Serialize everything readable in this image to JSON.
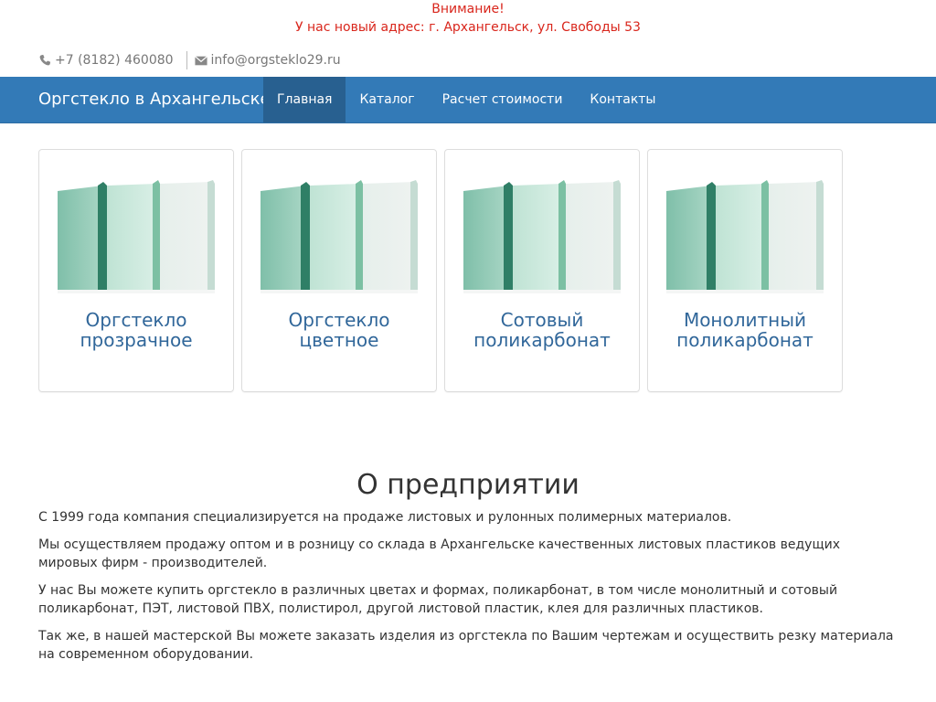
{
  "notice": {
    "title": "Внимание!",
    "text": "У нас новый адрес: г. Архангельск, ул. Свободы 53"
  },
  "contacts": {
    "phone": "+7 (8182) 460080",
    "email": "info@orgsteklo29.ru"
  },
  "navbar": {
    "brand": "Оргстекло в Архангельске",
    "items": [
      "Главная",
      "Каталог",
      "Расчет стоимости",
      "Контакты"
    ],
    "active": 0
  },
  "products": [
    {
      "line1": "Оргстекло",
      "line2": "прозрачное"
    },
    {
      "line1": "Оргстекло",
      "line2": "цветное"
    },
    {
      "line1": "Сотовый",
      "line2": "поликарбонат"
    },
    {
      "line1": "Монолитный",
      "line2": "поликарбонат"
    }
  ],
  "about": {
    "heading": "О предприятии",
    "paragraphs": [
      "С 1999 года компания специализируется на продаже листовых и рулонных полимерных материалов.",
      "Мы осуществляем продажу оптом и в розницу со склада в Архангельске качественных листовых пластиков ведущих мировых фирм - производителей.",
      "У нас Вы можете купить оргстекло в различных цветах и формах, поликарбонат, в том числе монолитный и сотовый поликарбонат, ПЭТ, листовой ПВХ, полистирол, другой листовой пластик, клея для различных пластиков.",
      "Так же, в нашей мастерской Вы можете заказать изделия из оргстекла по Вашим чертежам и осуществить резку материала на современном оборудовании."
    ]
  },
  "colors": {
    "navbar_bg": "#337ab7",
    "nav_active_bg": "#286090",
    "notice_red": "#d9261c",
    "card_title": "#31679a"
  },
  "icons": {
    "phone": "phone-icon",
    "email": "envelope-icon"
  }
}
